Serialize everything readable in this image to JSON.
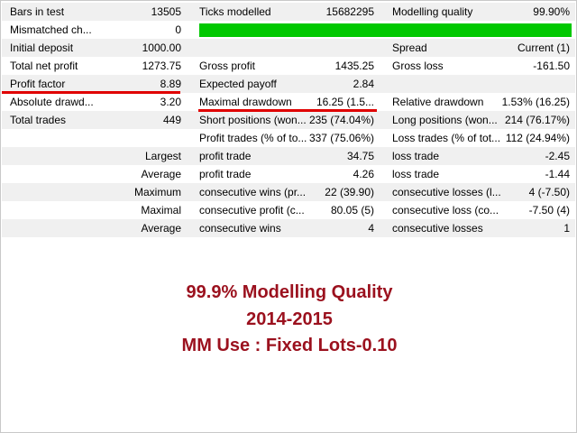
{
  "rows": [
    {
      "c1": "Bars in test",
      "v1": "13505",
      "c2": "Ticks modelled",
      "v2": "15682295",
      "c3": "Modelling quality",
      "v3": "99.90%"
    },
    {
      "c1": "Mismatched ch...",
      "v1": "0"
    },
    {
      "c1": "Initial deposit",
      "v1": "1000.00",
      "c3": "Spread",
      "v3": "Current (1)"
    },
    {
      "c1": "Total net profit",
      "v1": "1273.75",
      "c2": "Gross profit",
      "v2": "1435.25",
      "c3": "Gross loss",
      "v3": "-161.50"
    },
    {
      "c1": "Profit factor",
      "v1": "8.89",
      "c2": "Expected payoff",
      "v2": "2.84"
    },
    {
      "c1": "Absolute drawd...",
      "v1": "3.20",
      "c2": "Maximal drawdown",
      "v2": "16.25 (1.5...",
      "c3": "Relative drawdown",
      "v3": "1.53% (16.25)"
    },
    {
      "c1": "Total trades",
      "v1": "449",
      "c2": "Short positions (won...",
      "v2": "235 (74.04%)",
      "c3": "Long positions (won...",
      "v3": "214 (76.17%)"
    },
    {
      "c2": "Profit trades (% of to...",
      "v2": "337 (75.06%)",
      "c3": "Loss trades (% of tot...",
      "v3": "112 (24.94%)"
    },
    {
      "c1": "Largest",
      "c2": "profit trade",
      "v2": "34.75",
      "c3": "loss trade",
      "v3": "-2.45"
    },
    {
      "c1": "Average",
      "c2": "profit trade",
      "v2": "4.26",
      "c3": "loss trade",
      "v3": "-1.44"
    },
    {
      "c1": "Maximum",
      "c2": "consecutive wins (pr...",
      "v2": "22 (39.90)",
      "c3": "consecutive losses (l...",
      "v3": "4 (-7.50)"
    },
    {
      "c1": "Maximal",
      "c2": "consecutive profit (c...",
      "v2": "80.05 (5)",
      "c3": "consecutive loss (co...",
      "v3": "-7.50 (4)"
    },
    {
      "c1": "Average",
      "c2": "consecutive wins",
      "v2": "4",
      "c3": "consecutive losses",
      "v3": "1"
    }
  ],
  "modelling_quality_fraction": 0.999,
  "highlight_color": "#e00000",
  "bar_color": "#00c800",
  "overlay": {
    "line1": "99.9% Modelling Quality",
    "line2": "2014-2015",
    "line3": "MM Use : Fixed Lots-0.10"
  }
}
